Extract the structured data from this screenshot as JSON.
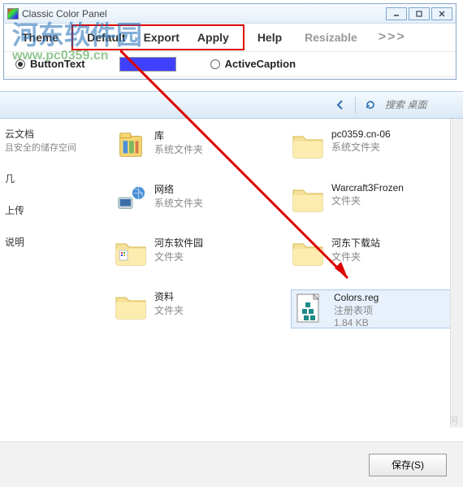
{
  "panel": {
    "title": "Classic Color Panel",
    "menu": {
      "theme": "Theme",
      "default": "Default",
      "export": "Export",
      "apply": "Apply",
      "help": "Help",
      "resizable": "Resizable",
      "more": ">>>"
    },
    "options": {
      "buttonText": "ButtonText",
      "activeCaption": "ActiveCaption"
    }
  },
  "watermark": {
    "cn": "河东软件园",
    "url": "www.pc0359.cn"
  },
  "toolbar": {
    "searchPlaceholder": "搜索 桌面"
  },
  "leftItems": [
    {
      "t1": "云文档",
      "t2": "且安全的储存空间"
    },
    {
      "t1": "几",
      "t2": ""
    },
    {
      "t1": "上传",
      "t2": ""
    },
    {
      "t1": "说明",
      "t2": ""
    }
  ],
  "files": [
    {
      "name": "库",
      "type": "系统文件夹",
      "icon": "library"
    },
    {
      "name": "pc0359.cn-06",
      "type": "系统文件夹",
      "icon": "folder"
    },
    {
      "name": "网络",
      "type": "系统文件夹",
      "icon": "network"
    },
    {
      "name": "Warcraft3Frozen",
      "type": "文件夹",
      "icon": "folder"
    },
    {
      "name": "河东软件园",
      "type": "文件夹",
      "icon": "folder-color"
    },
    {
      "name": "河东下载站",
      "type": "文件夹",
      "icon": "folder"
    },
    {
      "name": "资料",
      "type": "文件夹",
      "icon": "folder"
    },
    {
      "name": "Colors.reg",
      "type": "注册表项",
      "size": "1.84 KB",
      "icon": "reg",
      "selected": true
    }
  ],
  "bottom": {
    "save": "保存(S)"
  },
  "corner": "河"
}
